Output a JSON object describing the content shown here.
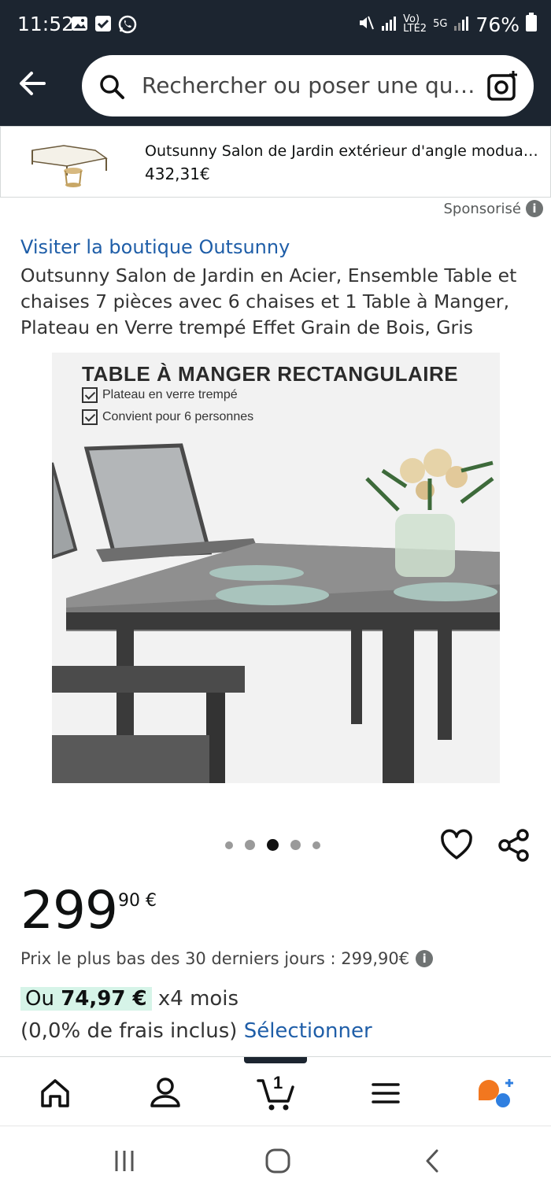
{
  "status_bar": {
    "time": "11:52",
    "network_label_top": "Vo)",
    "network_label_bottom": "LTE2",
    "network_5g": "5G",
    "battery": "76%"
  },
  "search": {
    "placeholder": "Rechercher ou poser une que..."
  },
  "sponsored_product": {
    "title": "Outsunny Salon de Jardin extérieur d'angle moduable...",
    "price": "432,31€",
    "sponsored_label": "Sponsorisé"
  },
  "product": {
    "store_link": "Visiter la boutique Outsunny",
    "title": "Outsunny Salon de Jardin en Acier, Ensemble Table et chaises 7 pièces avec 6 chaises et 1 Table à Manger, Plateau en Verre trempé Effet Grain de Bois, Gris",
    "image_heading": "TABLE À MANGER RECTANGULAIRE",
    "image_features": [
      "Plateau en verre trempé",
      "Convient pour 6 personnes"
    ],
    "carousel": {
      "count": 5,
      "active_index": 2
    }
  },
  "price": {
    "whole": "299",
    "fraction": "90 €",
    "lowest_30_days": "Prix le plus bas des 30 derniers jours : 299,90€",
    "installment_prefix": "Ou",
    "installment_amount": "74,97 €",
    "installment_suffix": "x4 mois",
    "fees_text": "(0,0% de frais inclus)",
    "select_link": "Sélectionner"
  },
  "bottom_nav": {
    "cart_count": "1",
    "items": [
      "home-icon",
      "account-icon",
      "cart-icon",
      "menu-icon",
      "rufus-icon"
    ]
  },
  "colors": {
    "header_bg": "#1c2530",
    "link": "#1f5ea8",
    "installment_highlight": "#d6f4e8",
    "rufus_orange": "#f2771f",
    "rufus_blue": "#2f7fe0"
  }
}
